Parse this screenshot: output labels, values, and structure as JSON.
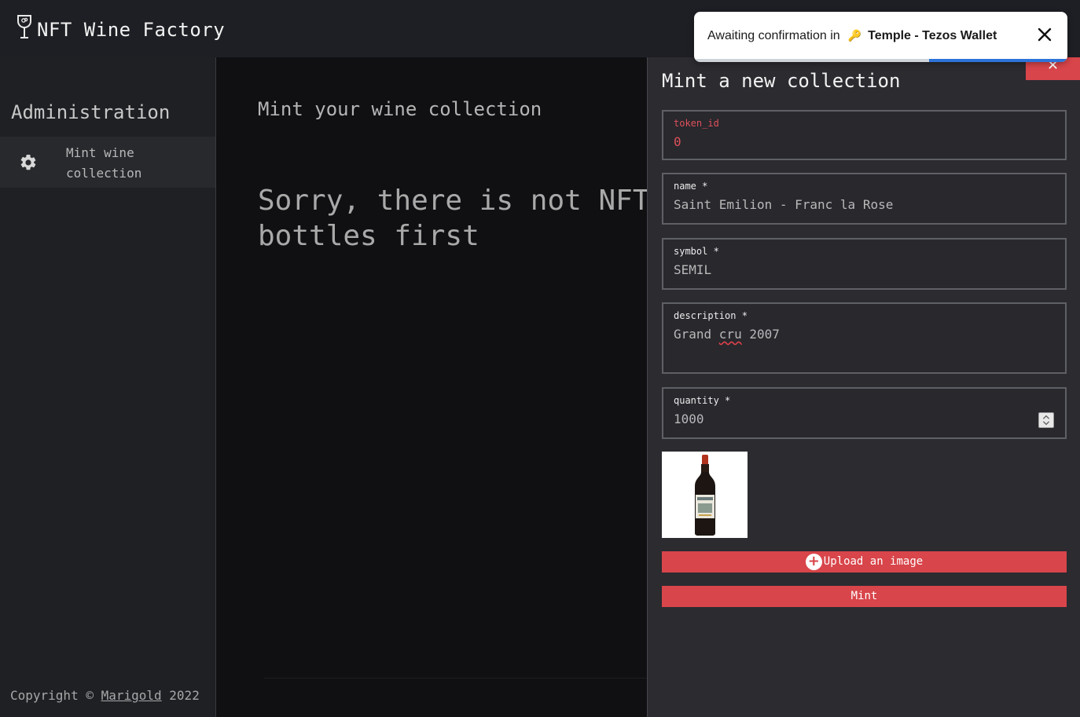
{
  "header": {
    "title": "NFT Wine Factory",
    "logo_icon": "wine-glass-icon"
  },
  "sidebar": {
    "title": "Administration",
    "items": [
      {
        "label": "Mint wine collection",
        "icon": "gear-icon"
      }
    ],
    "copyright_prefix": "Copyright © ",
    "copyright_link": "Marigold",
    "copyright_suffix": " 2022"
  },
  "main": {
    "title": "Mint your wine collection",
    "message_line1": "Sorry, there is not NFT yet, you need to mint",
    "message_line2": "bottles first"
  },
  "drawer": {
    "title": "Mint a new collection",
    "close_label": "✕",
    "fields": {
      "token_id": {
        "label": "token_id",
        "value": "0"
      },
      "name": {
        "label": "name *",
        "value": "Saint Emilion - Franc la Rose"
      },
      "symbol": {
        "label": "symbol *",
        "value": "SEMIL"
      },
      "description": {
        "label": "description *",
        "value_before": "Grand ",
        "value_misspelled": "cru",
        "value_after": " 2007"
      },
      "quantity": {
        "label": "quantity *",
        "value": "1000"
      }
    },
    "upload_label": "Upload an image",
    "mint_label": "Mint"
  },
  "toast": {
    "message": "Awaiting confirmation in",
    "wallet": "Temple - Tezos Wallet",
    "wallet_icon": "temple-key-icon",
    "progress": 0.37,
    "progress_color": "#2d74da"
  },
  "colors": {
    "accent": "#d8454a",
    "error": "#e0505a",
    "header_bg": "#1e1f24",
    "drawer_bg": "#2b2b30"
  }
}
